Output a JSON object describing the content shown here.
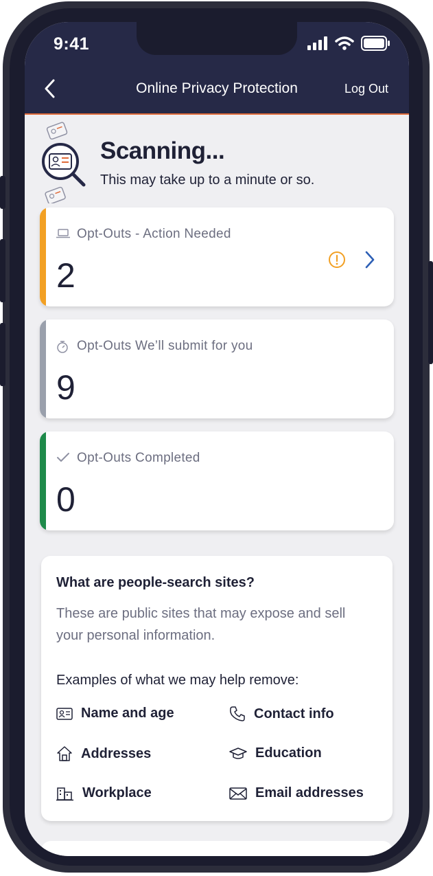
{
  "status_bar": {
    "time": "9:41"
  },
  "header": {
    "title": "Online Privacy Protection",
    "logout_label": "Log Out",
    "accent_color": "#e06a38",
    "background": "#262947"
  },
  "scan": {
    "title": "Scanning...",
    "subtitle": "This may take up to a minute or so."
  },
  "cards": [
    {
      "label": "Opt-Outs - Action Needed",
      "value": "2",
      "stripe_color": "#f2a024",
      "icon": "laptop-icon"
    },
    {
      "label": "Opt-Outs We’ll submit for you",
      "value": "9",
      "stripe_color": "#9aa0ac",
      "icon": "stopwatch-icon"
    },
    {
      "label": "Opt-Outs Completed",
      "value": "0",
      "stripe_color": "#1e8a4a",
      "icon": "checkmark-icon"
    }
  ],
  "info": {
    "title": "What are people-search sites?",
    "description": "These are public sites that may expose and sell your personal information.",
    "examples_heading": "Examples of what we may help remove:",
    "examples": [
      {
        "label": "Name and age",
        "icon": "id-card-icon"
      },
      {
        "label": "Contact info",
        "icon": "phone-icon"
      },
      {
        "label": "Addresses",
        "icon": "house-icon"
      },
      {
        "label": "Education",
        "icon": "graduation-cap-icon"
      },
      {
        "label": "Workplace",
        "icon": "building-icon"
      },
      {
        "label": "Email addresses",
        "icon": "envelope-icon"
      }
    ]
  }
}
